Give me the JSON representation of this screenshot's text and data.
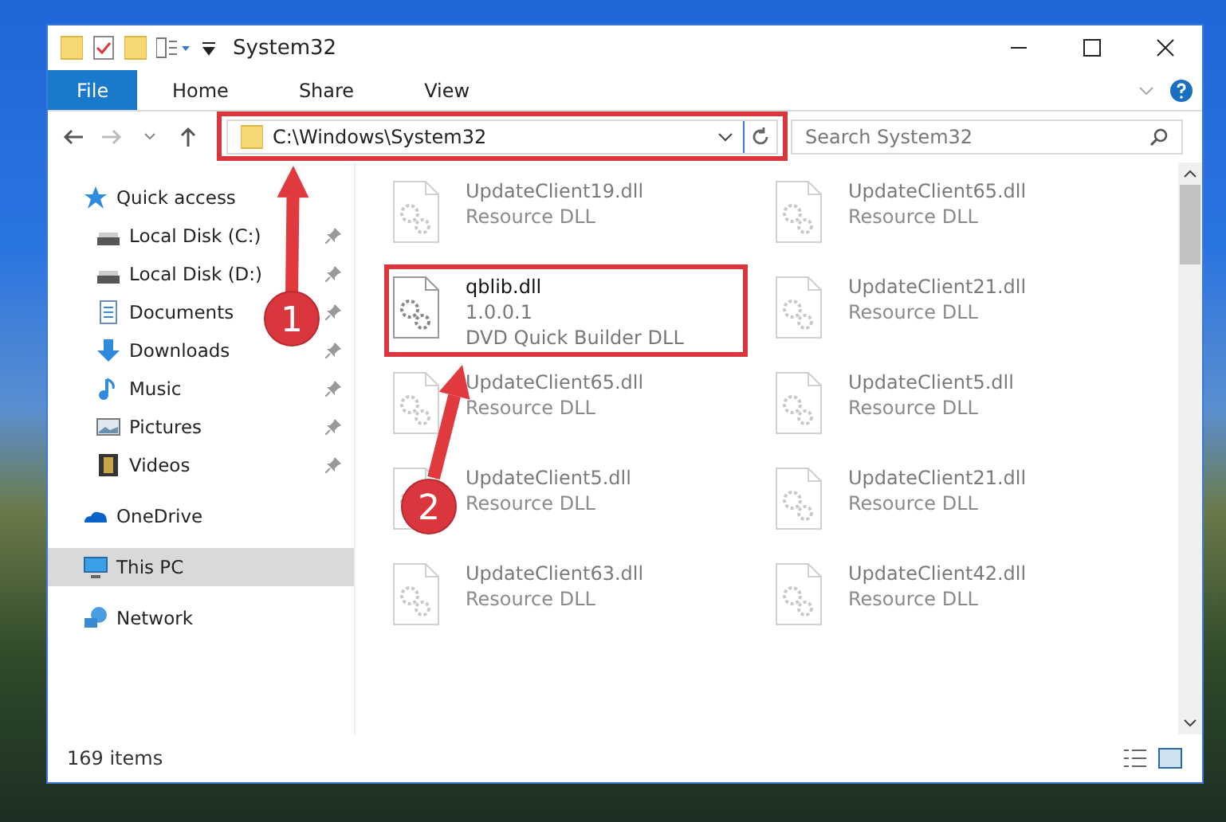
{
  "window": {
    "title": "System32"
  },
  "ribbon_tabs": [
    {
      "label": "File",
      "kind": "file",
      "selected": false
    },
    {
      "label": "Home",
      "kind": "tab",
      "selected": false
    },
    {
      "label": "Share",
      "kind": "tab",
      "selected": false
    },
    {
      "label": "View",
      "kind": "tab",
      "selected": false
    }
  ],
  "address_bar": {
    "path": "C:\\Windows\\System32"
  },
  "search": {
    "placeholder": "Search System32"
  },
  "sidebar": {
    "items": [
      {
        "label": "Quick access",
        "kind": "star",
        "selected": false,
        "children": [
          {
            "label": "Local Disk (C:)",
            "kind": "disk",
            "pinned": true,
            "selected": false
          },
          {
            "label": "Local Disk (D:)",
            "kind": "disk",
            "pinned": true,
            "selected": false
          },
          {
            "label": "Documents",
            "kind": "documents",
            "pinned": true,
            "selected": false
          },
          {
            "label": "Downloads",
            "kind": "downloads",
            "pinned": true,
            "selected": false
          },
          {
            "label": "Music",
            "kind": "music",
            "pinned": true,
            "selected": false
          },
          {
            "label": "Pictures",
            "kind": "pictures",
            "pinned": true,
            "selected": false
          },
          {
            "label": "Videos",
            "kind": "videos",
            "pinned": true,
            "selected": false
          }
        ]
      },
      {
        "label": "OneDrive",
        "kind": "cloud",
        "selected": false
      },
      {
        "label": "This PC",
        "kind": "pc",
        "selected": true
      },
      {
        "label": "Network",
        "kind": "network",
        "selected": false
      }
    ]
  },
  "files": [
    {
      "name": "UpdateClient19.dll",
      "lines": [
        "Resource DLL"
      ],
      "faded": true,
      "highlighted": false
    },
    {
      "name": "UpdateClient65.dll",
      "lines": [
        "Resource DLL"
      ],
      "faded": true,
      "highlighted": false
    },
    {
      "name": "qblib.dll",
      "lines": [
        "1.0.0.1",
        "DVD Quick Builder DLL"
      ],
      "faded": false,
      "highlighted": true
    },
    {
      "name": "UpdateClient21.dll",
      "lines": [
        "Resource DLL"
      ],
      "faded": true,
      "highlighted": false
    },
    {
      "name": "UpdateClient65.dll",
      "lines": [
        "Resource DLL"
      ],
      "faded": true,
      "highlighted": false
    },
    {
      "name": "UpdateClient5.dll",
      "lines": [
        "Resource DLL"
      ],
      "faded": true,
      "highlighted": false
    },
    {
      "name": "UpdateClient5.dll",
      "lines": [
        "Resource DLL"
      ],
      "faded": true,
      "highlighted": false
    },
    {
      "name": "UpdateClient21.dll",
      "lines": [
        "Resource DLL"
      ],
      "faded": true,
      "highlighted": false
    },
    {
      "name": "UpdateClient63.dll",
      "lines": [
        "Resource DLL"
      ],
      "faded": true,
      "highlighted": false
    },
    {
      "name": "UpdateClient42.dll",
      "lines": [
        "Resource DLL"
      ],
      "faded": true,
      "highlighted": false
    }
  ],
  "status_bar": {
    "count": "169 items"
  },
  "callouts": [
    {
      "number": "1"
    },
    {
      "number": "2"
    }
  ]
}
